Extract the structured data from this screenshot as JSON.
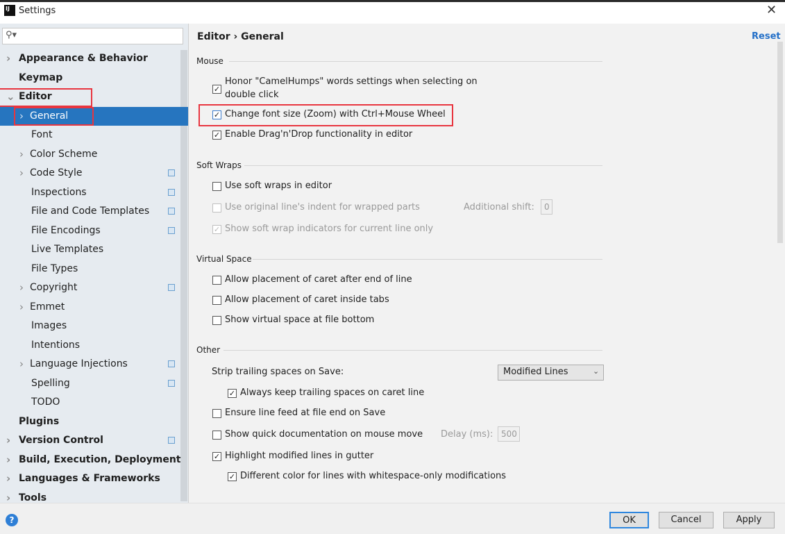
{
  "window": {
    "title": "Settings",
    "logo": "IJ"
  },
  "search": {
    "placeholder": "",
    "icon": "search-icon"
  },
  "sidebar": {
    "items": [
      {
        "label": "Appearance & Behavior",
        "bold": true,
        "arrow": ">"
      },
      {
        "label": "Keymap",
        "bold": true,
        "arrow": ""
      },
      {
        "label": "Editor",
        "bold": true,
        "arrow": "v"
      },
      {
        "label": "General",
        "selected": true,
        "arrow": ">"
      },
      {
        "label": "Font",
        "arrow": ""
      },
      {
        "label": "Color Scheme",
        "arrow": ">"
      },
      {
        "label": "Code Style",
        "arrow": ">",
        "copy": true
      },
      {
        "label": "Inspections",
        "copy": true
      },
      {
        "label": "File and Code Templates",
        "copy": true
      },
      {
        "label": "File Encodings",
        "copy": true
      },
      {
        "label": "Live Templates"
      },
      {
        "label": "File Types"
      },
      {
        "label": "Copyright",
        "arrow": ">",
        "copy": true
      },
      {
        "label": "Emmet",
        "arrow": ">"
      },
      {
        "label": "Images"
      },
      {
        "label": "Intentions"
      },
      {
        "label": "Language Injections",
        "arrow": ">",
        "copy": true
      },
      {
        "label": "Spelling",
        "copy": true
      },
      {
        "label": "TODO"
      },
      {
        "label": "Plugins",
        "bold": true
      },
      {
        "label": "Version Control",
        "bold": true,
        "arrow": ">",
        "copy": true
      },
      {
        "label": "Build, Execution, Deployment",
        "bold": true,
        "arrow": ">"
      },
      {
        "label": "Languages & Frameworks",
        "bold": true,
        "arrow": ">"
      },
      {
        "label": "Tools",
        "bold": true,
        "arrow": ">"
      }
    ]
  },
  "header": {
    "breadcrumb_1": "Editor",
    "sep": "›",
    "breadcrumb_2": "General",
    "reset": "Reset"
  },
  "mouse": {
    "title": "Mouse",
    "camel_1": "Honor \"CamelHumps\" words settings when selecting on",
    "camel_2": "double click",
    "zoom": "Change font size (Zoom) with Ctrl+Mouse Wheel",
    "dnd": "Enable Drag'n'Drop functionality in editor"
  },
  "soft_wraps": {
    "title": "Soft Wraps",
    "use": "Use soft wraps in editor",
    "indent": "Use original line's indent for wrapped parts",
    "shift_label": "Additional shift:",
    "shift_value": "0",
    "indicators": "Show soft wrap indicators for current line only"
  },
  "virtual_space": {
    "title": "Virtual Space",
    "after_end": "Allow placement of caret after end of line",
    "inside_tabs": "Allow placement of caret inside tabs",
    "file_bottom": "Show virtual space at file bottom"
  },
  "other": {
    "title": "Other",
    "strip_label": "Strip trailing spaces on Save:",
    "strip_value": "Modified Lines",
    "keep_trailing": "Always keep trailing spaces on caret line",
    "line_feed": "Ensure line feed at file end on Save",
    "quick_doc": "Show quick documentation on mouse move",
    "delay_label": "Delay (ms):",
    "delay_value": "500",
    "highlight": "Highlight modified lines in gutter",
    "diff_color": "Different color for lines with whitespace-only modifications"
  },
  "footer": {
    "help": "?",
    "ok": "OK",
    "cancel": "Cancel",
    "apply": "Apply"
  },
  "colors": {
    "selection": "#2675bf",
    "highlight_box": "#e8353f",
    "link": "#2470c8"
  }
}
